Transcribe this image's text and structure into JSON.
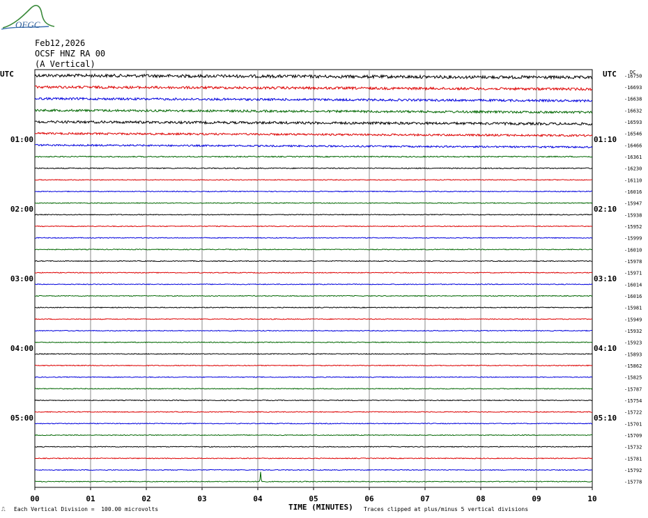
{
  "logo_text": "OFGC",
  "header": {
    "date": "Feb12,2026",
    "station": "OCSF HNZ RA 00",
    "component": "(A Vertical)"
  },
  "left_axis_title": "UTC",
  "right_axis_title": "UTC",
  "right_offset_title": "DC",
  "footer": {
    "scale_note": "Each Vertical Division =  100.00 microvolts",
    "x_title": "TIME (MINUTES)",
    "clip_note": "Traces clipped at plus/minus 5 vertical divisions"
  },
  "colors": {
    "trace_cycle": [
      "#000000",
      "#dd0000",
      "#0000dd",
      "#006600"
    ],
    "grid": "#888888"
  },
  "chart_data": {
    "type": "line",
    "title": "",
    "xlabel": "TIME (MINUTES)",
    "xlim": [
      0,
      10
    ],
    "x_ticks": [
      "00",
      "01",
      "02",
      "03",
      "04",
      "05",
      "06",
      "07",
      "08",
      "09",
      "10"
    ],
    "grid": true,
    "left_time_labels": [
      {
        "row": 6,
        "label": "01:00"
      },
      {
        "row": 12,
        "label": "02:00"
      },
      {
        "row": 18,
        "label": "03:00"
      },
      {
        "row": 24,
        "label": "04:00"
      },
      {
        "row": 30,
        "label": "05:00"
      }
    ],
    "right_time_labels": [
      {
        "row": 6,
        "label": "01:10"
      },
      {
        "row": 12,
        "label": "02:10"
      },
      {
        "row": 18,
        "label": "03:10"
      },
      {
        "row": 24,
        "label": "04:10"
      },
      {
        "row": 30,
        "label": "05:10"
      }
    ],
    "row_dc_offsets": [
      "-16750",
      "-16693",
      "-16638",
      "-16632",
      "-16593",
      "-16546",
      "-16466",
      "-16361",
      "-16230",
      "-16110",
      "-16016",
      "-15947",
      "-15938",
      "-15952",
      "-15999",
      "-16010",
      "-15978",
      "-15971",
      "-16014",
      "-16016",
      "-15981",
      "-15949",
      "-15932",
      "-15923",
      "-15893",
      "-15862",
      "-15825",
      "-15787",
      "-15754",
      "-15722",
      "-15701",
      "-15709",
      "-15732",
      "-15781",
      "-15792",
      "-15778"
    ],
    "row_amplitude": [
      2.2,
      1.8,
      1.6,
      1.6,
      1.8,
      1.4,
      1.2,
      0.8,
      0.7,
      0.6,
      0.6,
      0.6,
      0.6,
      0.6,
      0.6,
      0.6,
      0.6,
      0.6,
      0.6,
      0.6,
      0.6,
      0.6,
      0.6,
      0.6,
      0.6,
      0.6,
      0.6,
      0.6,
      0.6,
      0.6,
      0.6,
      0.6,
      0.6,
      0.6,
      0.6,
      0.6
    ],
    "events": [
      {
        "row": 35,
        "minute": 4.05,
        "amplitude": 14
      }
    ]
  }
}
